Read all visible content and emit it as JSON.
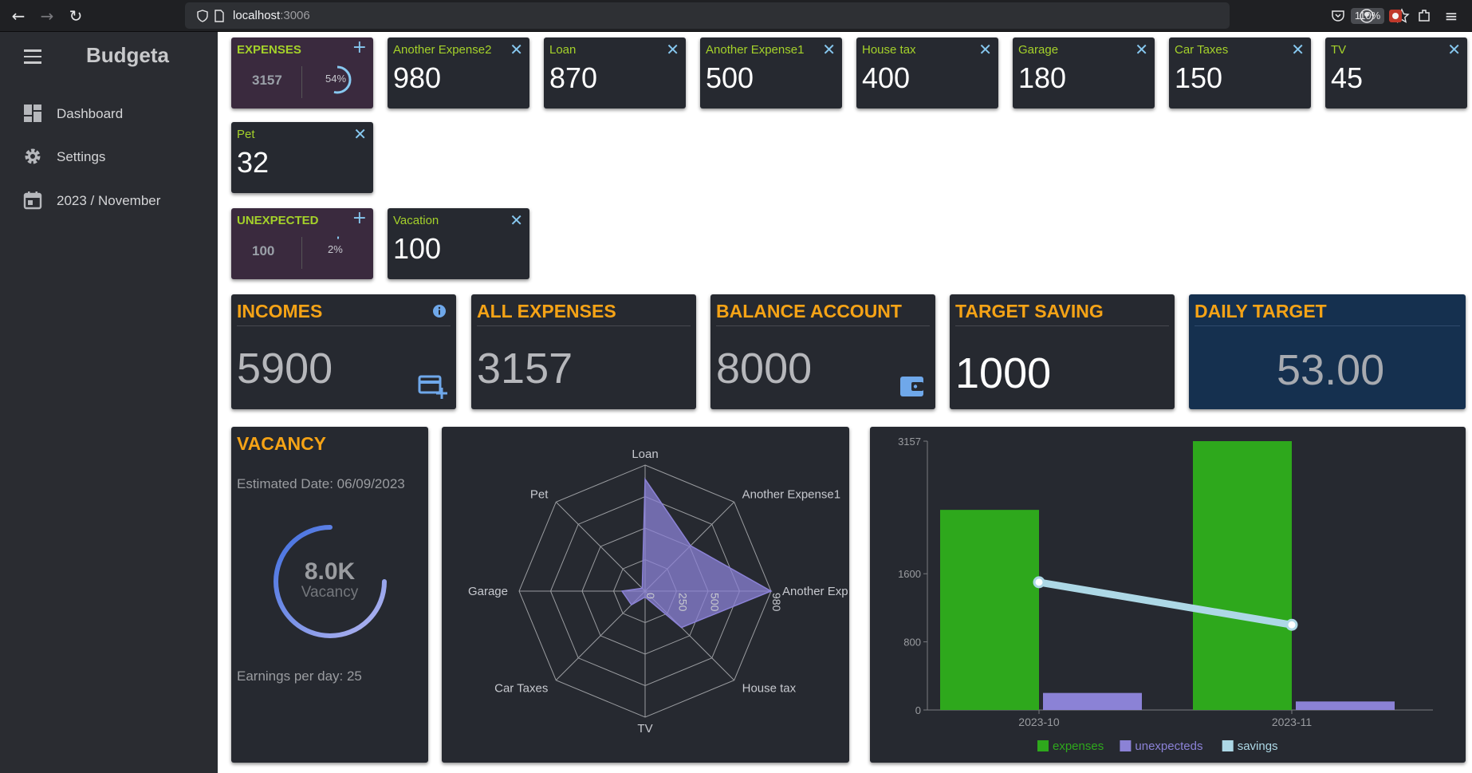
{
  "browser": {
    "url_host": "localhost",
    "url_port": ":3006",
    "zoom": "110%"
  },
  "sidebar": {
    "app_title": "Budgeta",
    "items": [
      {
        "label": "Dashboard",
        "icon": "dashboard-icon"
      },
      {
        "label": "Settings",
        "icon": "gear-icon"
      },
      {
        "label": "2023 / November",
        "icon": "calendar-icon"
      }
    ]
  },
  "expenses_summary": {
    "label": "EXPENSES",
    "total": "3157",
    "percent": "54%",
    "fraction": 0.54
  },
  "expense_cards": [
    {
      "label": "Another Expense2",
      "value": "980"
    },
    {
      "label": "Loan",
      "value": "870"
    },
    {
      "label": "Another Expense1",
      "value": "500"
    },
    {
      "label": "House tax",
      "value": "400"
    },
    {
      "label": "Garage",
      "value": "180"
    },
    {
      "label": "Car Taxes",
      "value": "150"
    },
    {
      "label": "TV",
      "value": "45"
    },
    {
      "label": "Pet",
      "value": "32"
    }
  ],
  "unexpected_summary": {
    "label": "UNEXPECTED",
    "total": "100",
    "percent": "2%",
    "fraction": 0.02
  },
  "unexpected_cards": [
    {
      "label": "Vacation",
      "value": "100"
    }
  ],
  "stats": {
    "incomes": {
      "label": "INCOMES",
      "value": "5900"
    },
    "all_expenses": {
      "label": "ALL EXPENSES",
      "value": "3157"
    },
    "balance": {
      "label": "BALANCE ACCOUNT",
      "value": "8000"
    },
    "target_saving": {
      "label": "TARGET SAVING",
      "value": "1000"
    },
    "daily_target": {
      "label": "DAILY TARGET",
      "value": "53.00"
    }
  },
  "vacancy": {
    "title": "VACANCY",
    "estimated": "Estimated Date: 06/09/2023",
    "gauge_value": "8.0K",
    "gauge_label": "Vacancy",
    "earnings": "Earnings per day: 25"
  },
  "colors": {
    "expenses": "#2ea81c",
    "unexpecteds": "#8b82d6",
    "savings": "#add8e6",
    "accent": "#f5a316",
    "green_label": "#a4d12a"
  },
  "chart_data": [
    {
      "type": "radar",
      "axes": [
        "Loan",
        "Another Expense1",
        "Another Exp",
        "House tax",
        "TV",
        "Car Taxes",
        "Garage",
        "Pet"
      ],
      "values": [
        870,
        500,
        980,
        400,
        45,
        150,
        180,
        32
      ],
      "max": 980,
      "ticks": [
        "0",
        "250",
        "500",
        "980"
      ]
    },
    {
      "type": "bar",
      "categories": [
        "2023-10",
        "2023-11"
      ],
      "series": [
        {
          "name": "expenses",
          "type": "bar",
          "values": [
            2350,
            3157
          ]
        },
        {
          "name": "unexpecteds",
          "type": "bar",
          "values": [
            200,
            100
          ]
        },
        {
          "name": "savings",
          "type": "line",
          "values": [
            1500,
            1000
          ]
        }
      ],
      "y_ticks": [
        "0",
        "800",
        "1600",
        "3157"
      ],
      "ylim": [
        0,
        3157
      ],
      "legend": "bottom"
    }
  ]
}
